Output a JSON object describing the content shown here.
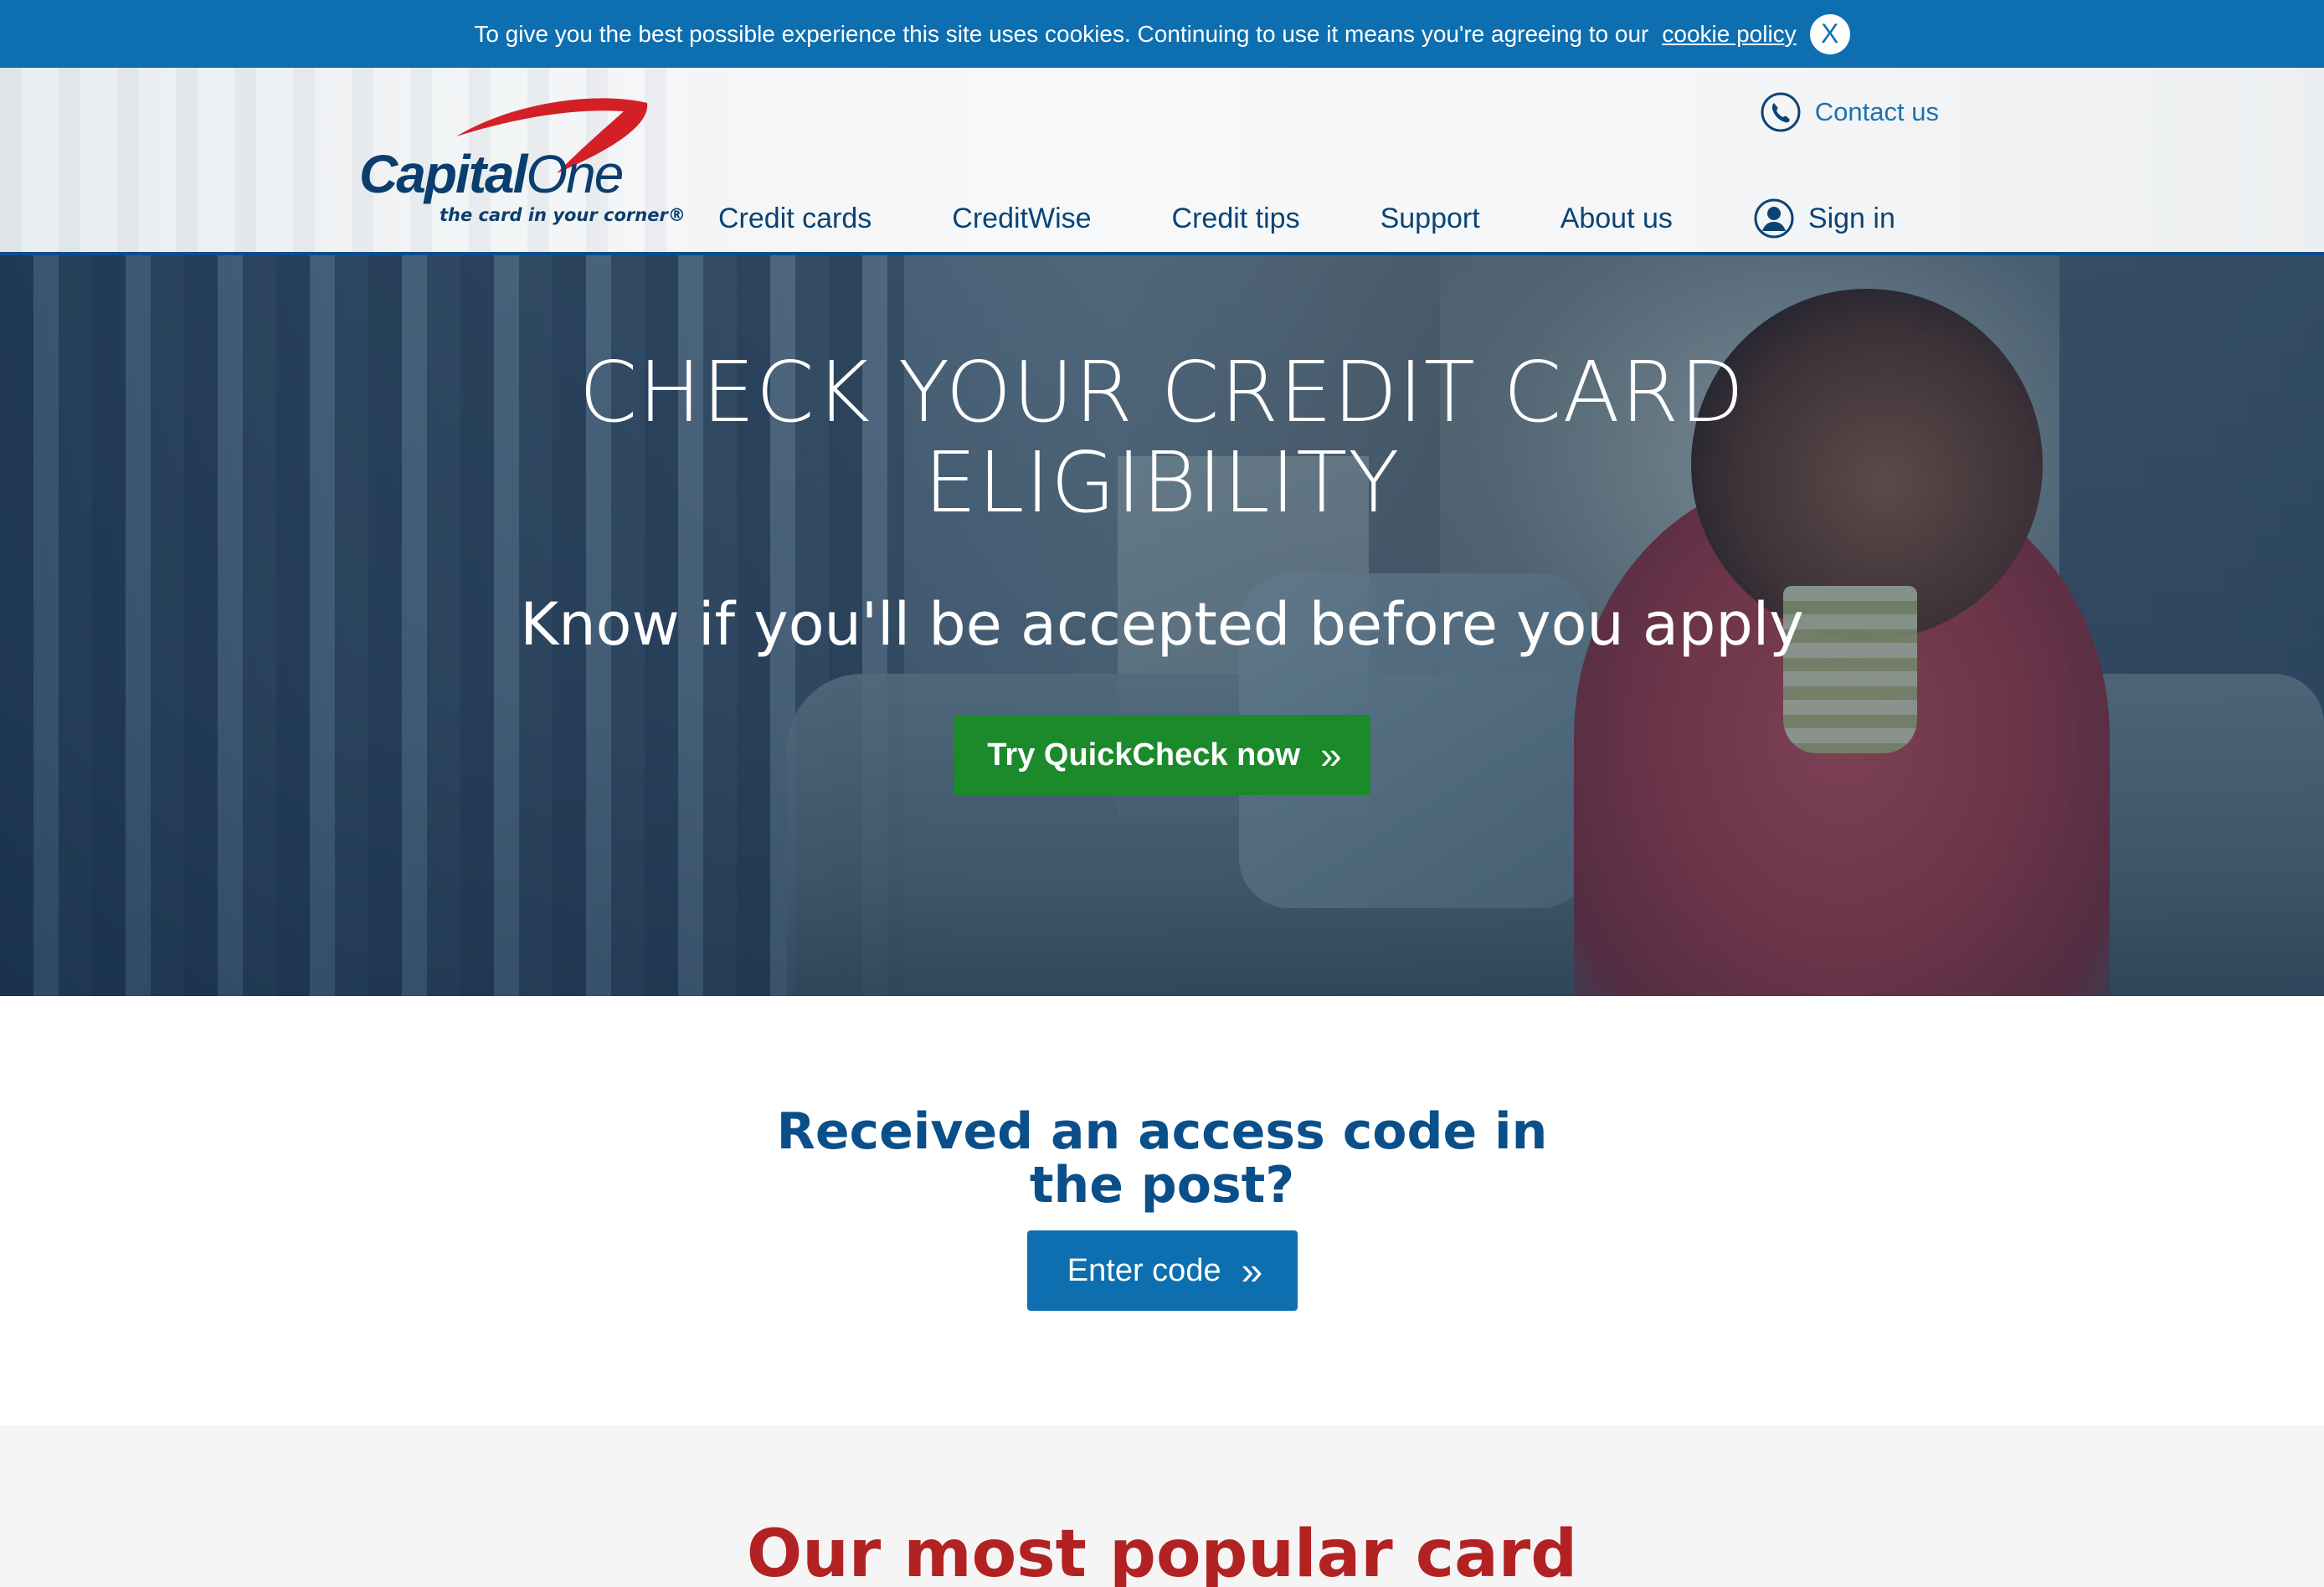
{
  "cookie_bar": {
    "text": "To give you the best possible experience this site uses cookies. Continuing to use it means you're agreeing to our",
    "link": "cookie policy",
    "close_label": "X"
  },
  "header": {
    "logo_word_capital": "Capital",
    "logo_word_one": "One",
    "logo_tagline": "the card in your corner®",
    "contact_label": "Contact us",
    "nav": [
      "Credit cards",
      "CreditWise",
      "Credit tips",
      "Support",
      "About us"
    ],
    "signin_label": "Sign in"
  },
  "hero": {
    "title_line1": "CHECK YOUR CREDIT CARD",
    "title_line2": "ELIGIBILITY",
    "subtitle": "Know if you'll be accepted before you apply",
    "cta_label": "Try QuickCheck now",
    "cta_chevrons": "»"
  },
  "access": {
    "title_line1": "Received an access code in",
    "title_line2": "the post?",
    "button_label": "Enter code",
    "button_chevrons": "»"
  },
  "popular": {
    "title": "Our most popular card"
  },
  "colors": {
    "brand_blue": "#0d6fb0",
    "nav_blue": "#0a4475",
    "cta_green": "#1b8a2a",
    "logo_red": "#d32027",
    "popular_red": "#b22222"
  },
  "icons": {
    "phone": "phone-icon",
    "user": "user-icon",
    "close": "close-icon",
    "chevron": "double-chevron-right-icon"
  }
}
